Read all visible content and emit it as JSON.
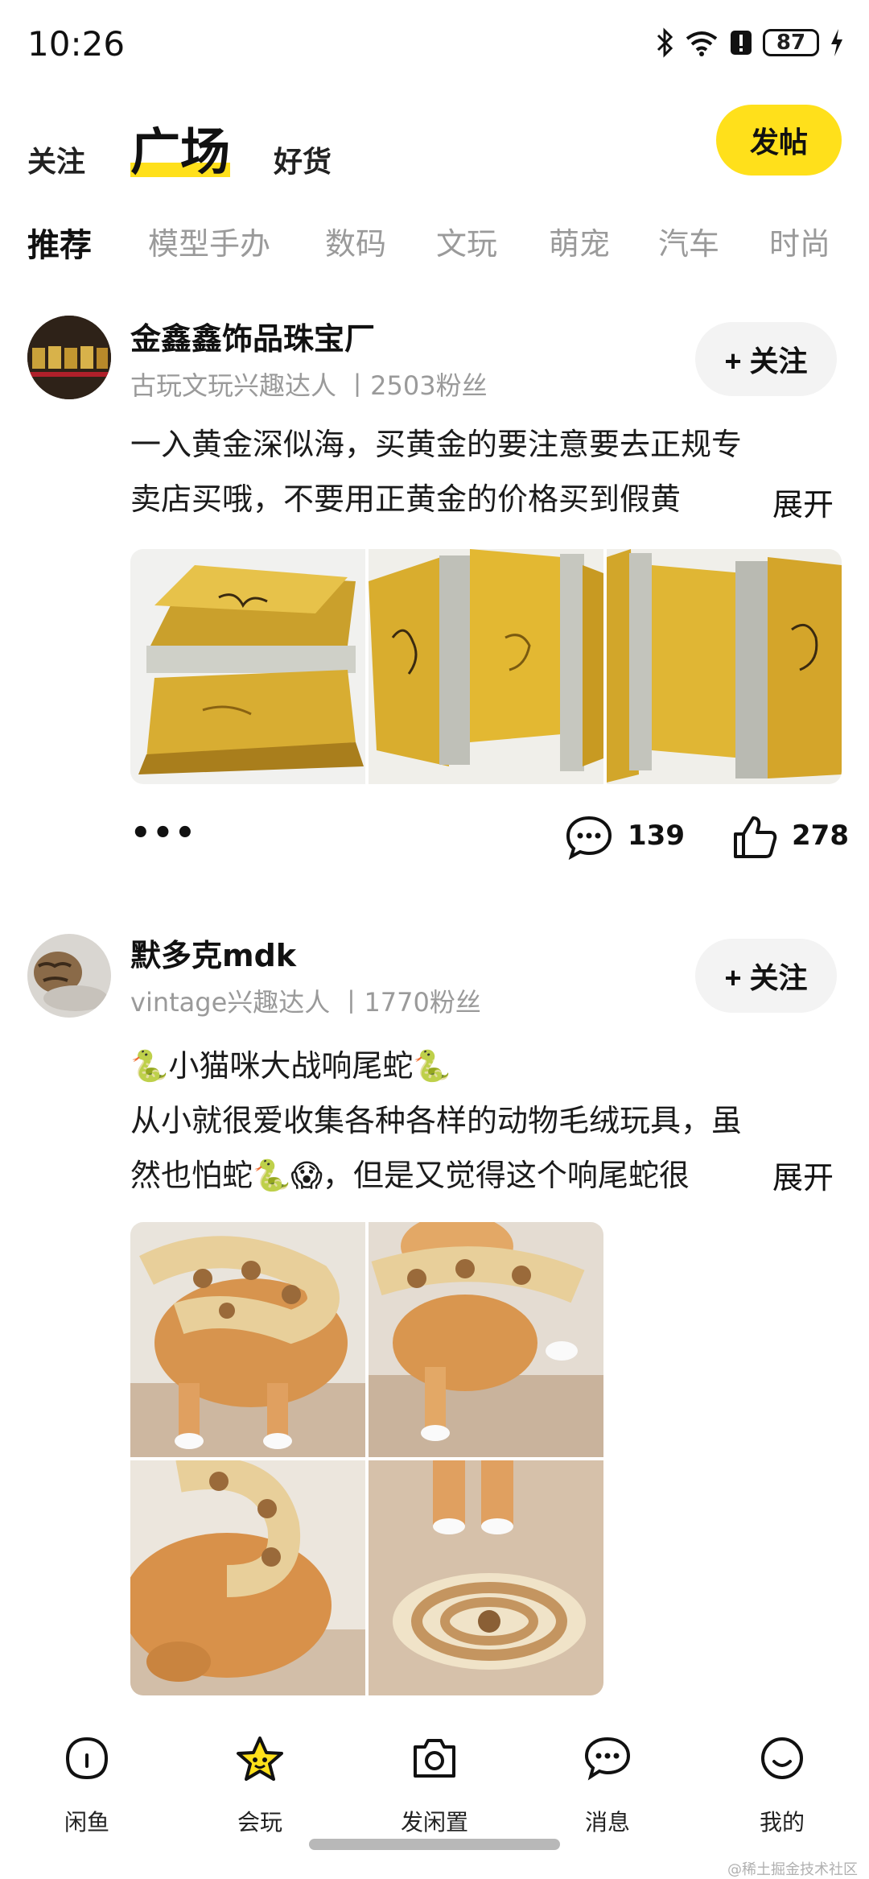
{
  "status_bar": {
    "time": "10:26",
    "battery": "87"
  },
  "header": {
    "tabs": [
      {
        "label": "关注"
      },
      {
        "label": "广场"
      },
      {
        "label": "好货"
      }
    ],
    "post_button": "发帖"
  },
  "categories": [
    "推荐",
    "模型手办",
    "数码",
    "文玩",
    "萌宠",
    "汽车",
    "时尚"
  ],
  "posts": [
    {
      "username": "金鑫鑫饰品珠宝厂",
      "meta": "古玩文玩兴趣达人 丨2503粉丝",
      "follow": "+ 关注",
      "text_lines": [
        "一入黄金深似海，买黄金的要注意要去正规专",
        "卖店买哦，不要用正黄金的价格买到假黄"
      ],
      "expand": "展开",
      "more": "•••",
      "comments": "139",
      "likes": "278"
    },
    {
      "username": "默多克mdk",
      "meta": "vintage兴趣达人 丨1770粉丝",
      "follow": "+ 关注",
      "title": "🐍小猫咪大战响尾蛇🐍",
      "text_lines": [
        "从小就很爱收集各种各样的动物毛绒玩具，虽",
        "然也怕蛇🐍😱，但是又觉得这个响尾蛇很"
      ],
      "expand": "展开"
    }
  ],
  "bottom_nav": [
    {
      "label": "闲鱼",
      "icon": "home-icon"
    },
    {
      "label": "会玩",
      "icon": "star-icon"
    },
    {
      "label": "发闲置",
      "icon": "camera-icon"
    },
    {
      "label": "消息",
      "icon": "message-icon"
    },
    {
      "label": "我的",
      "icon": "smile-icon"
    }
  ],
  "watermark": "@稀土掘金技术社区",
  "colors": {
    "accent": "#ffe01b",
    "muted": "#9a9a9a",
    "gold": "#d6a723"
  }
}
